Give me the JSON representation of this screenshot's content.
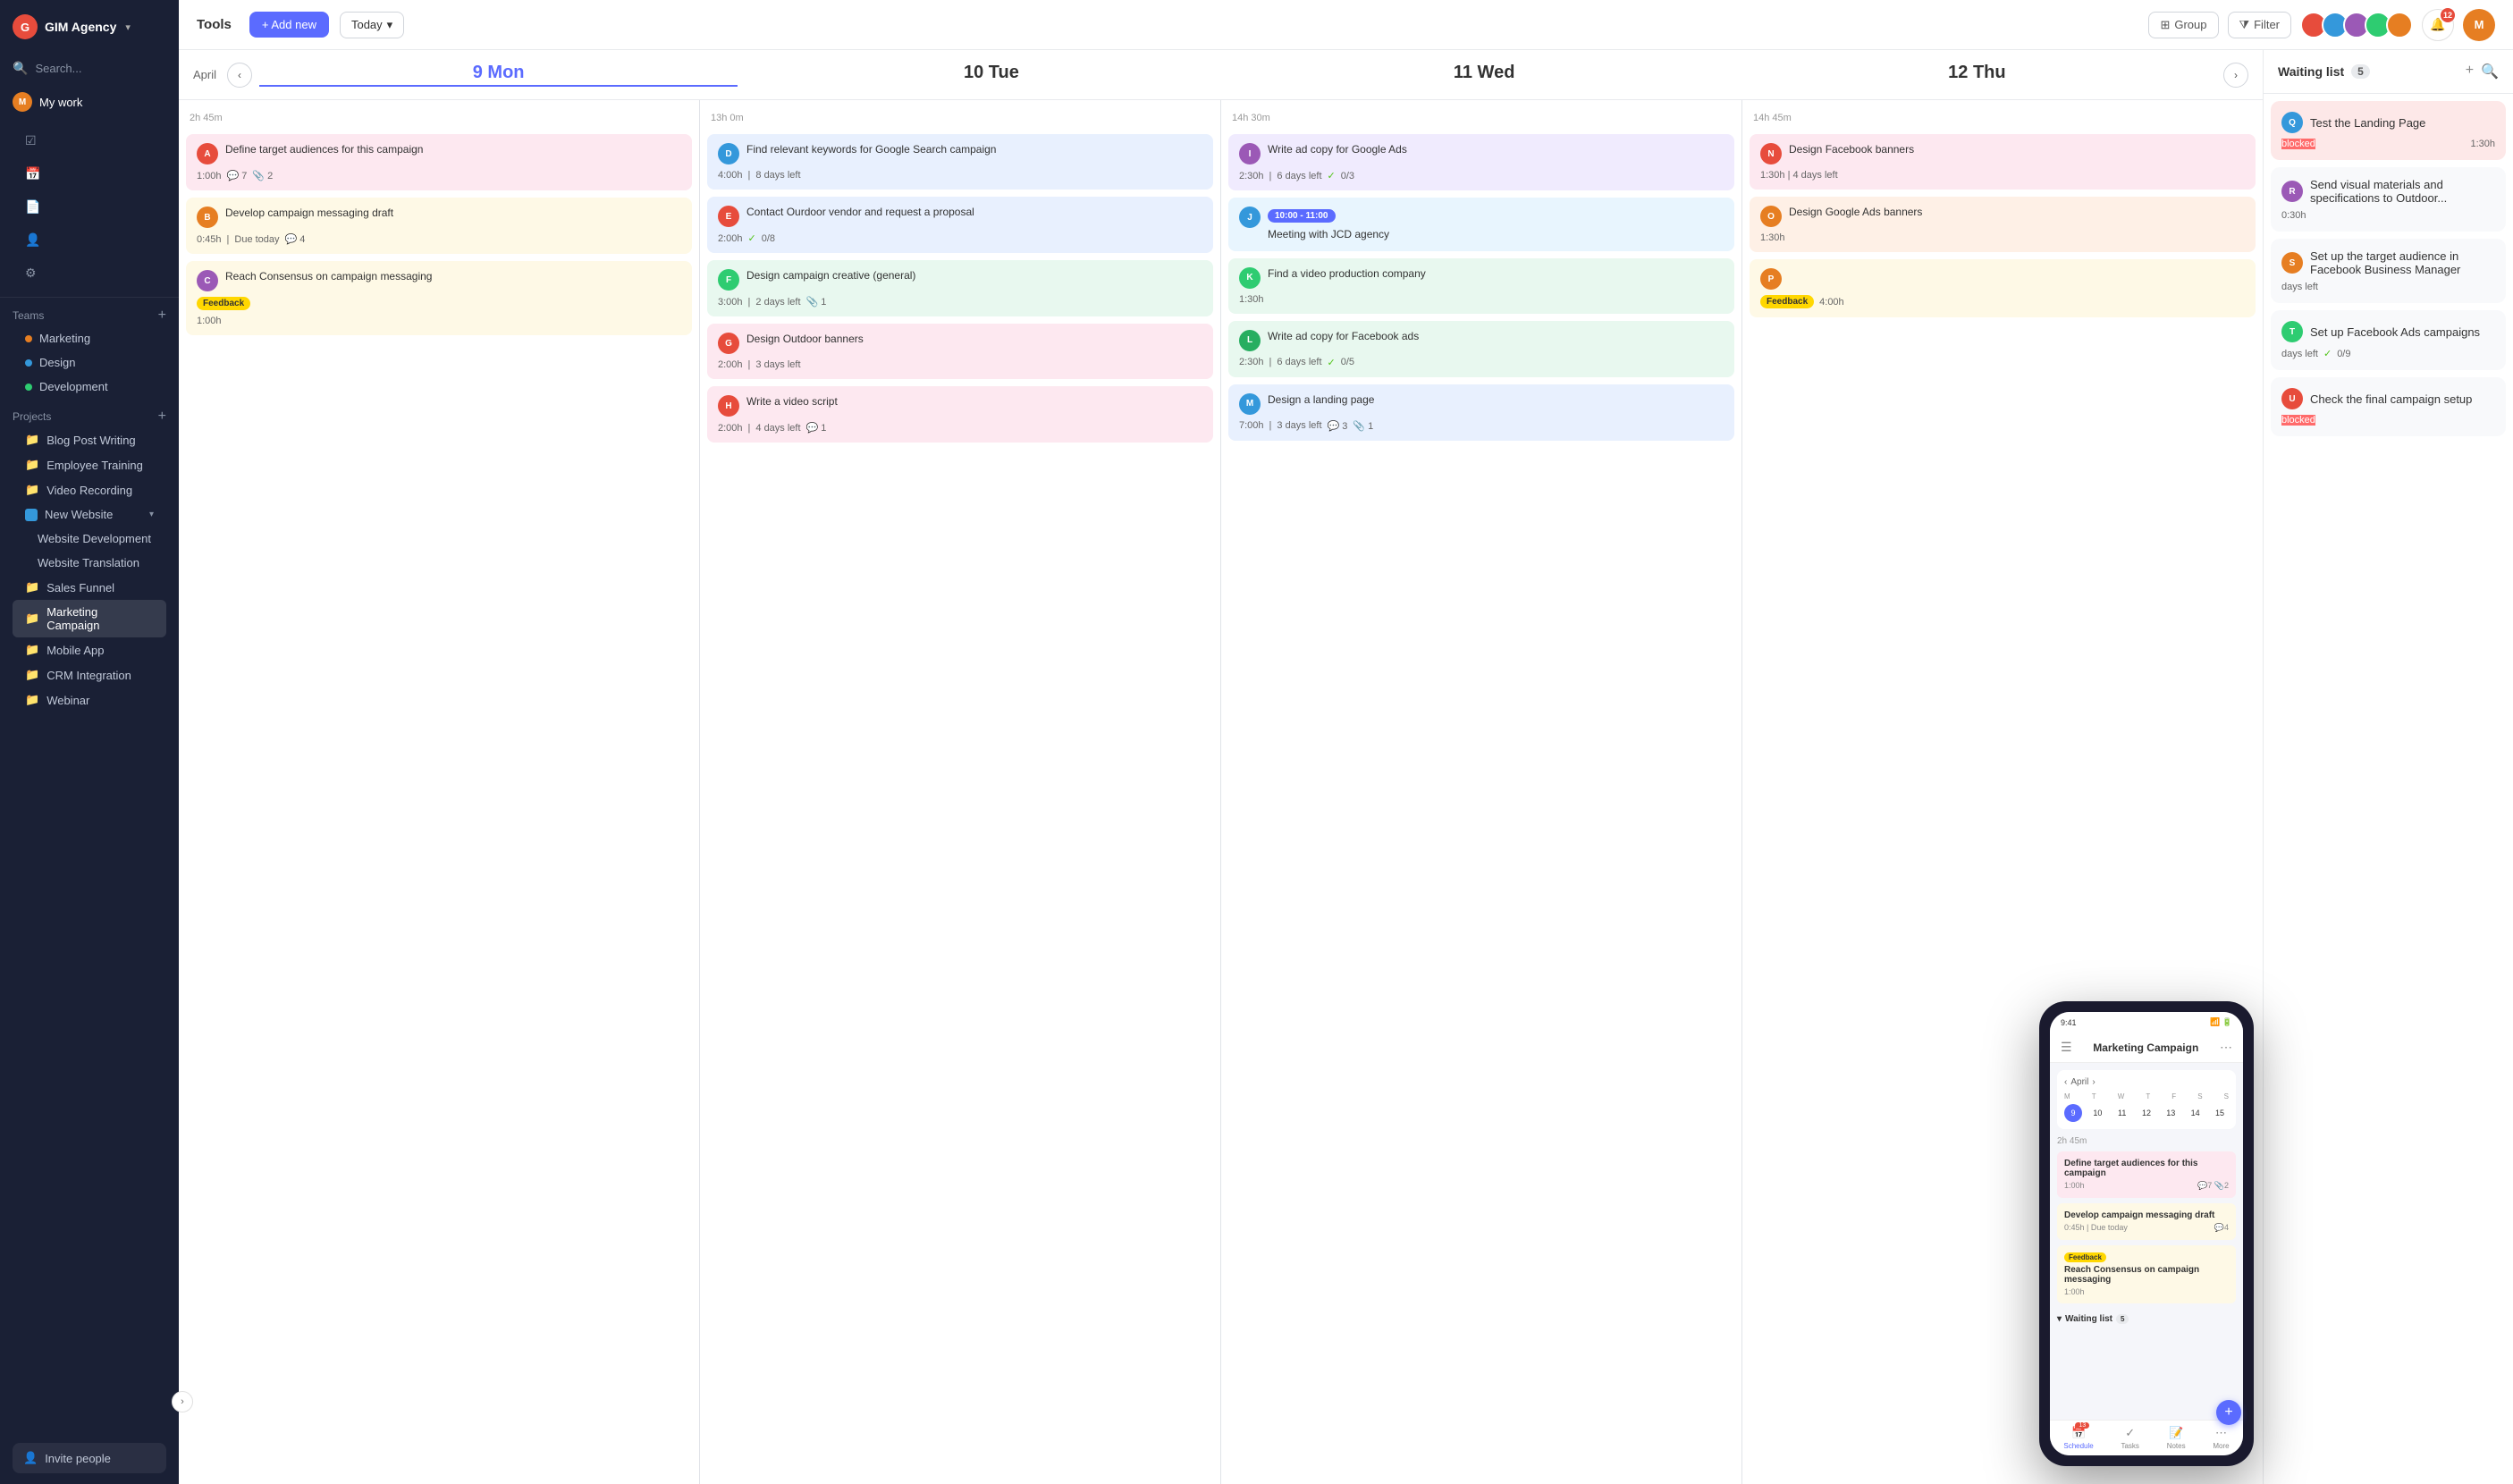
{
  "app": {
    "name": "GIM Agency",
    "logo_letter": "G"
  },
  "toolbar": {
    "title": "Tools",
    "add_btn": "+ Add new",
    "today_btn": "Today",
    "group_btn": "Group",
    "filter_btn": "Filter"
  },
  "sidebar": {
    "search_placeholder": "Search...",
    "my_work_label": "My work",
    "teams_label": "Teams",
    "teams": [
      {
        "name": "Marketing",
        "color": "orange"
      },
      {
        "name": "Design",
        "color": "blue"
      },
      {
        "name": "Development",
        "color": "green"
      }
    ],
    "projects_label": "Projects",
    "projects": [
      {
        "name": "Blog Post Writing"
      },
      {
        "name": "Employee Training"
      },
      {
        "name": "Video Recording"
      },
      {
        "name": "New Website",
        "has_children": true,
        "expanded": true
      },
      {
        "name": "Website Development",
        "sub": true
      },
      {
        "name": "Website Translation",
        "sub": true
      },
      {
        "name": "Sales Funnel"
      },
      {
        "name": "Marketing Campaign",
        "active": true
      },
      {
        "name": "Mobile App"
      },
      {
        "name": "CRM Integration"
      },
      {
        "name": "Webinar"
      }
    ],
    "invite_label": "Invite people"
  },
  "calendar": {
    "month": "April",
    "days": [
      {
        "num": "9",
        "name": "Mon",
        "today": true,
        "hours": "2h 45m"
      },
      {
        "num": "10",
        "name": "Tue",
        "hours": "13h 0m"
      },
      {
        "num": "11",
        "name": "Wed",
        "hours": "14h 30m"
      },
      {
        "num": "12",
        "name": "Thu",
        "hours": "14h 45m"
      }
    ],
    "columns": [
      {
        "day": 9,
        "tasks": [
          {
            "id": 1,
            "title": "Define target audiences for this campaign",
            "time": "1:00h",
            "meta": "7 💬 2 📎",
            "color": "pink",
            "avatar_color": "#e74c3c"
          },
          {
            "id": 2,
            "title": "Develop campaign messaging draft",
            "time": "0:45h",
            "meta": "Due today | 4 💬",
            "color": "yellow",
            "avatar_color": "#e67e22"
          },
          {
            "id": 3,
            "title": "Reach Consensus on campaign messaging",
            "time": "1:00h",
            "badge": "Feedback",
            "color": "yellow",
            "avatar_color": "#9b59b6"
          }
        ]
      },
      {
        "day": 10,
        "tasks": [
          {
            "id": 4,
            "title": "Find relevant keywords for Google Search campaign",
            "time": "4:00h",
            "meta": "8 days left",
            "color": "blue",
            "avatar_color": "#3498db"
          },
          {
            "id": 5,
            "title": "Contact Ourdoor vendor and request a proposal",
            "time": "2:00h",
            "meta": "0/8 ✓",
            "color": "blue",
            "avatar_color": "#e74c3c"
          },
          {
            "id": 6,
            "title": "Design campaign creative (general)",
            "time": "3:00h",
            "meta": "2 days left | 1 📎",
            "color": "green",
            "avatar_color": "#2ecc71"
          },
          {
            "id": 7,
            "title": "Design Outdoor banners",
            "time": "2:00h",
            "meta": "3 days left",
            "color": "pink",
            "avatar_color": "#e74c3c"
          },
          {
            "id": 8,
            "title": "Write a video script",
            "time": "2:00h",
            "meta": "4 days left | 1 💬",
            "color": "pink",
            "avatar_color": "#e74c3c"
          }
        ]
      },
      {
        "day": 11,
        "tasks": [
          {
            "id": 9,
            "title": "Write ad copy for Google Ads",
            "time": "2:30h",
            "meta": "6 days left | 0/3 ✓",
            "color": "purple",
            "avatar_color": "#9b59b6"
          },
          {
            "id": 10,
            "time_range": "10:00 - 11:00",
            "title": "Meeting with JCD agency",
            "color": "light-blue",
            "avatar_color": "#3498db"
          },
          {
            "id": 11,
            "title": "Find a video production company",
            "time": "1:30h",
            "color": "green",
            "avatar_color": "#2ecc71"
          },
          {
            "id": 12,
            "title": "Write ad copy for Facebook ads",
            "time": "2:30h",
            "meta": "6 days left | 0/5 ✓",
            "color": "green",
            "avatar_color": "#27ae60"
          },
          {
            "id": 13,
            "title": "Design a landing page",
            "time": "7:00h",
            "meta": "3 days left | 3 💬 1 📎",
            "color": "blue",
            "avatar_color": "#3498db"
          }
        ]
      },
      {
        "day": 12,
        "tasks": [
          {
            "id": 14,
            "title": "Design Facebook banners",
            "time": "1:30h",
            "meta": "4 days left",
            "color": "pink",
            "avatar_color": "#e74c3c"
          },
          {
            "id": 15,
            "title": "Design Google Ads banners",
            "time": "1:30h",
            "color": "orange",
            "avatar_color": "#e67e22"
          },
          {
            "id": 16,
            "title": "",
            "time": "4:00h",
            "badge": "Feedback",
            "color": "yellow",
            "partial": true
          }
        ]
      }
    ]
  },
  "waiting_list": {
    "title": "Waiting list",
    "count": 5,
    "items": [
      {
        "id": 1,
        "title": "Test the Landing Page",
        "badge": "blocked",
        "time": "1:30h",
        "avatar_color": "#3498db"
      },
      {
        "id": 2,
        "title": "Send visual materials and specifications to Outdoor...",
        "time": "0:30h",
        "avatar_color": "#9b59b6"
      },
      {
        "id": 3,
        "title": "Set up the target audience in Facebook Business Manager",
        "meta": "days left",
        "avatar_color": "#e67e22"
      },
      {
        "id": 4,
        "title": "Set up Facebook Ads campaigns",
        "meta": "days left | 0/9 ✓",
        "avatar_color": "#2ecc71"
      },
      {
        "id": 5,
        "title": "Check the final campaign setup",
        "badge": "blocked",
        "avatar_color": "#e74c3c"
      }
    ]
  },
  "mobile": {
    "time": "9:41",
    "header_title": "Marketing Campaign",
    "schedule_tab": "Schedule",
    "tasks_tab": "Tasks",
    "notes_tab": "Notes",
    "more_tab": "More",
    "schedule_badge": "13",
    "mini_cal": {
      "month": "April",
      "day_names": [
        "M",
        "T",
        "W",
        "T",
        "F",
        "S",
        "S"
      ],
      "days": [
        9,
        10,
        11,
        12,
        13,
        14,
        15
      ],
      "today": 9
    },
    "hours_label": "2h 45m",
    "tasks": [
      {
        "title": "Define target audiences for this campaign",
        "time": "1:00h",
        "meta": "7 💬 2 📎",
        "color": "pink"
      },
      {
        "title": "Develop campaign messaging draft",
        "time": "0:45h",
        "meta": "Due today | 4 💬",
        "color": "yellow"
      },
      {
        "title": "Reach Consensus on campaign messaging",
        "time": "1:00h",
        "badge": "Feedback",
        "color": "yellow"
      }
    ],
    "waiting_label": "Waiting list",
    "waiting_count": "5"
  },
  "notifications": {
    "count": "12"
  },
  "avatars": [
    "#e74c3c",
    "#3498db",
    "#9b59b6",
    "#2ecc71",
    "#e67e22"
  ]
}
